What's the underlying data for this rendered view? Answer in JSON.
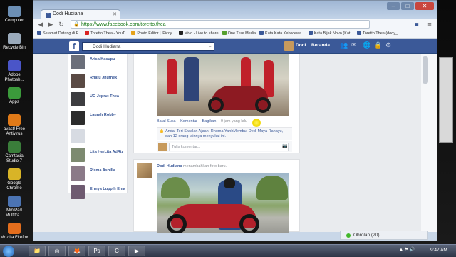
{
  "desktop": {
    "icons": [
      {
        "label": "Computer",
        "color": "#6c8fb5"
      },
      {
        "label": "Recycle Bin",
        "color": "#9aaabb"
      },
      {
        "label": "Adobe Photosh...",
        "color": "#4a55c8"
      },
      {
        "label": "Apps",
        "color": "#3b9a3b"
      },
      {
        "label": "avast! Free Antivirus",
        "color": "#e07a18"
      },
      {
        "label": "Camtasia Studio 7",
        "color": "#3a7d3a"
      },
      {
        "label": "Google Chrome",
        "color": "#d8b427"
      },
      {
        "label": "MiniPad Multitra...",
        "color": "#4c74b3"
      },
      {
        "label": "Mozilla Firefox",
        "color": "#e46e1d"
      }
    ]
  },
  "browser": {
    "tab_title": "Dodi Hudiana",
    "url": "https://www.facebook.com/toretto.thea",
    "bookmarks": [
      {
        "label": "Selamat Datang di F...",
        "color": "#3b5998"
      },
      {
        "label": "Toretto Thea - YouT...",
        "color": "#d92323"
      },
      {
        "label": "Photo Editor | iPiccy...",
        "color": "#e6a21a"
      },
      {
        "label": "Mivo - Live to share",
        "color": "#222222"
      },
      {
        "label": "One True Media",
        "color": "#56a02e"
      },
      {
        "label": "Kata Kata Kekecewa...",
        "color": "#3b5998"
      },
      {
        "label": "Kata Bijak Novo (Kat...",
        "color": "#3b5998"
      },
      {
        "label": "Toretto Thea (dody_...",
        "color": "#3b5998"
      }
    ]
  },
  "facebook": {
    "brand_color": "#3b5998",
    "search_value": "Dodi Hudiana",
    "profile_name": "Dodi",
    "home_label": "Beranda",
    "friends": [
      {
        "name": "Arisa Kasupu",
        "color": "#6b6f7a"
      },
      {
        "name": "Rhatu Jhuthek",
        "color": "#5a4a44"
      },
      {
        "name": "UG Jeprut Thea",
        "color": "#3d3d40"
      },
      {
        "name": "Laurah Robby",
        "color": "#2c2c2c"
      },
      {
        "name": "",
        "color": "#d7dbe2"
      },
      {
        "name": "Lita HerLita AdRiz",
        "color": "#7d8a70"
      },
      {
        "name": "Risma Ashilla",
        "color": "#8b7a88"
      },
      {
        "name": "Ermya Luppih Ema",
        "color": "#6e5a70"
      }
    ],
    "post1": {
      "actions": [
        "Batal Suka",
        "Komentar",
        "Bagikan",
        "9 jam yang lalu"
      ],
      "likes_text": "Anda, Teri Siwalan Ajaah, Rhoma YanhMembu, Dedi Maya Rahayu, dan 12 orang lainnya menyukai ini.",
      "comment_placeholder": "Tulis komentar..."
    },
    "post2": {
      "author": "Dodi Hudiana",
      "action_text": "menambahkan foto baru."
    },
    "chat_label": "Obrolan (20)"
  },
  "taskbar": {
    "time": "9:47 AM"
  }
}
